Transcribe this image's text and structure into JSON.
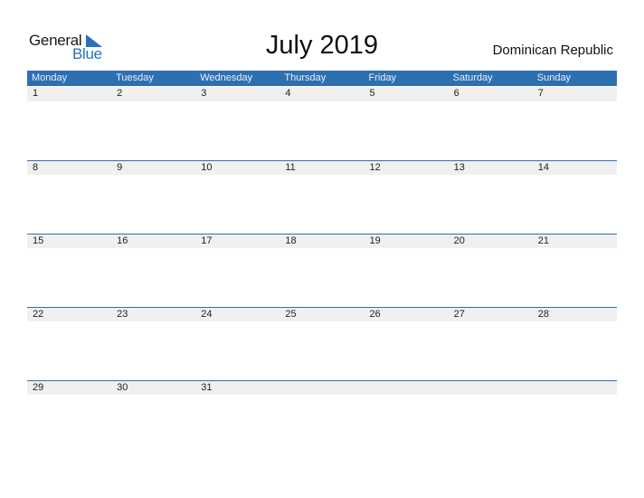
{
  "logo": {
    "line1": "General",
    "line2": "Blue"
  },
  "title": "July 2019",
  "country": "Dominican Republic",
  "colors": {
    "accent": "#2e6fb0",
    "row_bg": "#f0f0f0"
  },
  "weekdays": [
    "Monday",
    "Tuesday",
    "Wednesday",
    "Thursday",
    "Friday",
    "Saturday",
    "Sunday"
  ],
  "weeks": [
    [
      "1",
      "2",
      "3",
      "4",
      "5",
      "6",
      "7"
    ],
    [
      "8",
      "9",
      "10",
      "11",
      "12",
      "13",
      "14"
    ],
    [
      "15",
      "16",
      "17",
      "18",
      "19",
      "20",
      "21"
    ],
    [
      "22",
      "23",
      "24",
      "25",
      "26",
      "27",
      "28"
    ],
    [
      "29",
      "30",
      "31",
      "",
      "",
      "",
      ""
    ]
  ]
}
